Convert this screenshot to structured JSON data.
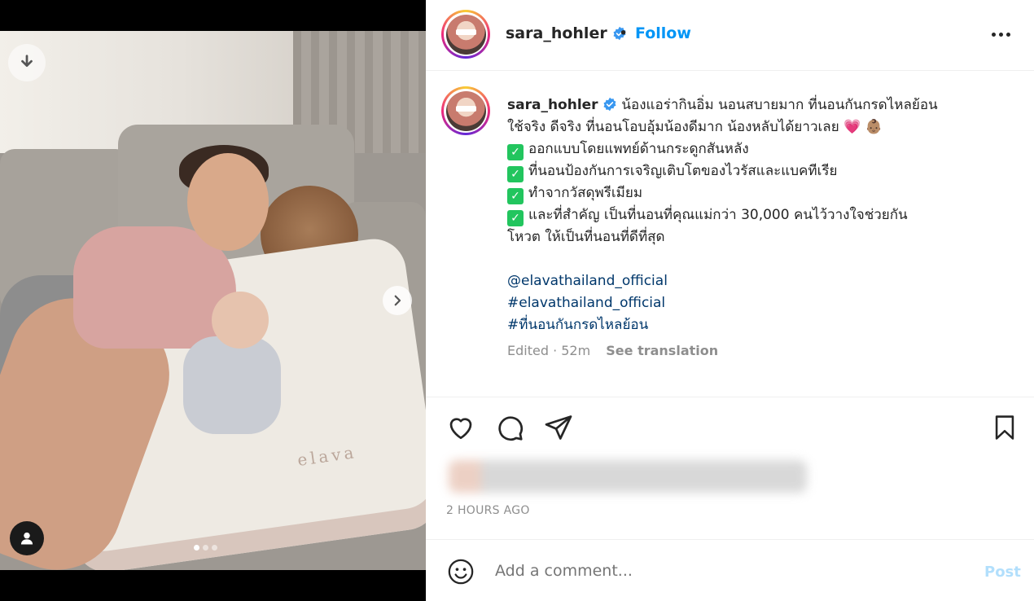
{
  "post": {
    "username": "sara_hohler",
    "follow_label": "Follow",
    "separator": "•",
    "verified": true,
    "caption_lines": [
      "น้องแอร่ากินอิ่ม นอนสบายมาก ที่นอนกันกรดไหลย้อน",
      "ใช้จริง ดีจริง ที่นอนโอบอุ้มน้องดีมาก น้องหลับได้ยาวเลย 💗 👶🏽",
      "ออกแบบโดยแพทย์ด้านกระดูกสันหลัง",
      "ที่นอนป้องกันการเจริญเติบโตของไวรัสและแบคทีเรีย",
      "ทำจากวัสดุพรีเมียม",
      "และที่สำคัญ เป็นที่นอนที่คุณแม่กว่า 30,000 คนไว้วางใจช่วยกัน",
      "โหวต ให้เป็นที่นอนที่ดีที่สุด"
    ],
    "mention": "@elavathailand_official",
    "hashtag1": "#elavathailand_official",
    "hashtag2": "#ที่นอนกันกรดไหลย้อน",
    "edited_meta": "Edited · 52m",
    "see_translation": "See translation",
    "timestamp": "2 HOURS AGO",
    "comment_placeholder": "Add a comment...",
    "post_label": "Post",
    "media_brand_text": "elava",
    "carousel": {
      "count": 3,
      "active": 0
    },
    "colors": {
      "follow": "#0095f6",
      "link": "#00376b",
      "post_disabled": "#b2dffc",
      "check": "#22c55e"
    }
  },
  "icons": {
    "download": "download-icon",
    "next": "chevron-right-icon",
    "user": "user-icon",
    "more": "more-horizontal-icon",
    "like": "heart-icon",
    "comment": "comment-icon",
    "share": "send-icon",
    "save": "bookmark-icon",
    "emoji": "emoji-icon",
    "verified": "verified-badge-icon"
  }
}
